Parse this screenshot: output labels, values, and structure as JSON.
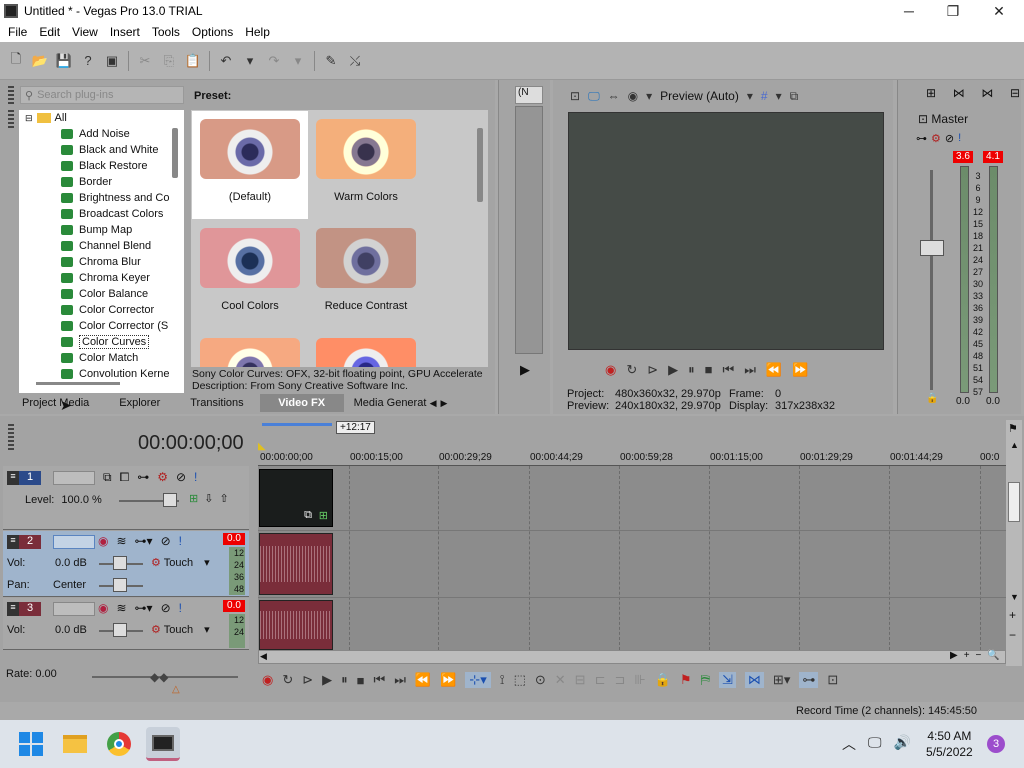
{
  "window": {
    "title": "Untitled * - Vegas Pro 13.0 TRIAL",
    "minimize": "─",
    "maximize": "❐",
    "close": "✕"
  },
  "menu": [
    "File",
    "Edit",
    "View",
    "Insert",
    "Tools",
    "Options",
    "Help"
  ],
  "plugins": {
    "search_placeholder": "Search plug-ins",
    "root": "All",
    "items": [
      "Add Noise",
      "Black and White",
      "Black Restore",
      "Border",
      "Brightness and Co",
      "Broadcast Colors",
      "Bump Map",
      "Channel Blend",
      "Chroma Blur",
      "Chroma Keyer",
      "Color Balance",
      "Color Corrector",
      "Color Corrector (S",
      "Color Curves",
      "Color Match",
      "Convolution Kerne"
    ],
    "selected": "Color Curves"
  },
  "presets": {
    "label": "Preset:",
    "items": [
      "(Default)",
      "Warm Colors",
      "Cool Colors",
      "Reduce Contrast"
    ],
    "selected": "(Default)",
    "info_line1": "Sony Color Curves: OFX, 32-bit floating point, GPU Accelerate",
    "info_line2": "Description: From Sony Creative Software Inc."
  },
  "tabs": [
    "Project Media",
    "Explorer",
    "Transitions",
    "Video FX",
    "Media Generat"
  ],
  "active_tab": "Video FX",
  "trimmer": {
    "dropdown": "(N"
  },
  "preview": {
    "mode": "Preview (Auto)",
    "project_label": "Project:",
    "project_value": "480x360x32, 29.970p",
    "frame_label": "Frame:",
    "frame_value": "0",
    "preview_label": "Preview:",
    "preview_value": "240x180x32, 29.970p",
    "display_label": "Display:",
    "display_value": "317x238x32"
  },
  "master": {
    "label": "Master",
    "peak_left": "3.6",
    "peak_right": "4.1",
    "scale": [
      "3",
      "6",
      "9",
      "12",
      "15",
      "18",
      "21",
      "24",
      "27",
      "30",
      "33",
      "36",
      "39",
      "42",
      "45",
      "48",
      "51",
      "54",
      "57"
    ],
    "level_left": "0.0",
    "level_right": "0.0"
  },
  "timeline": {
    "timecode": "00:00:00;00",
    "region_marker": "+12:17",
    "ruler": [
      "00:00:00;00",
      "00:00:15;00",
      "00:00:29;29",
      "00:00:44;29",
      "00:00:59;28",
      "00:01:15;00",
      "00:01:29;29",
      "00:01:44;29",
      "00:0"
    ],
    "tracks": [
      {
        "num": "1",
        "type": "video",
        "level_label": "Level:",
        "level_value": "100.0 %"
      },
      {
        "num": "2",
        "type": "audio",
        "vol_label": "Vol:",
        "vol_value": "0.0 dB",
        "pan_label": "Pan:",
        "pan_value": "Center",
        "mode": "Touch",
        "peak": "0.0",
        "meter": [
          "12",
          "24",
          "36",
          "48"
        ]
      },
      {
        "num": "3",
        "type": "audio",
        "vol_label": "Vol:",
        "vol_value": "0.0 dB",
        "mode": "Touch",
        "peak": "0.0",
        "meter": [
          "12",
          "24"
        ]
      }
    ],
    "rate": "Rate: 0.00"
  },
  "status": {
    "record_time": "Record Time (2 channels): 145:45:50"
  },
  "taskbar": {
    "time": "4:50 AM",
    "date": "5/5/2022",
    "notifications": "3"
  }
}
